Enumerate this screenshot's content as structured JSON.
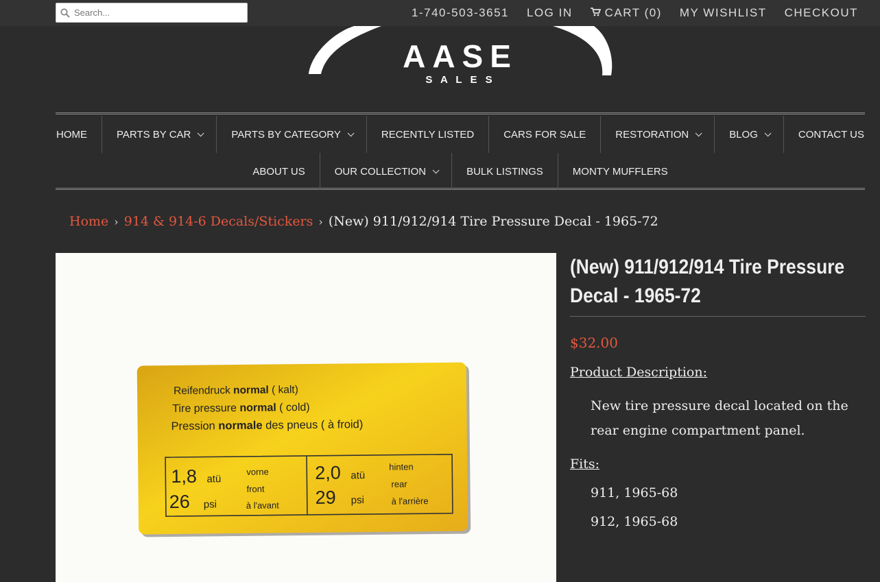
{
  "search": {
    "placeholder": "Search..."
  },
  "top_links": {
    "phone": "1-740-503-3651",
    "login": "LOG IN",
    "cart_label": "CART",
    "cart_count": "(0)",
    "wishlist": "MY WISHLIST",
    "checkout": "CHECKOUT"
  },
  "logo": {
    "text": "AASE",
    "subtext": "S A L E S"
  },
  "nav": {
    "row1": [
      {
        "label": "HOME",
        "dropdown": false
      },
      {
        "label": "PARTS BY CAR",
        "dropdown": true
      },
      {
        "label": "PARTS BY CATEGORY",
        "dropdown": true
      },
      {
        "label": "RECENTLY LISTED",
        "dropdown": false
      },
      {
        "label": "CARS FOR SALE",
        "dropdown": false
      },
      {
        "label": "RESTORATION",
        "dropdown": true
      },
      {
        "label": "BLOG",
        "dropdown": true
      },
      {
        "label": "CONTACT US",
        "dropdown": false
      }
    ],
    "row2": [
      {
        "label": "ABOUT US",
        "dropdown": false
      },
      {
        "label": "OUR COLLECTION",
        "dropdown": true
      },
      {
        "label": "BULK LISTINGS",
        "dropdown": false
      },
      {
        "label": "MONTY MUFFLERS",
        "dropdown": false
      }
    ]
  },
  "breadcrumb": {
    "home": "Home",
    "category": "914 & 914-6 Decals/Stickers",
    "current": "(New) 911/912/914 Tire Pressure Decal - 1965-72"
  },
  "decal": {
    "line1_a": "Reifendruck ",
    "line1_b": "normal",
    "line1_c": " ( kalt)",
    "line2_a": "Tire pressure ",
    "line2_b": "normal",
    "line2_c": " ( cold)",
    "line3_a": "Pression ",
    "line3_b": "normale",
    "line3_c": " des pneus ( à froid)",
    "front_atu": "1,8",
    "front_psi": "26",
    "rear_atu": "2,0",
    "rear_psi": "29",
    "unit_atu": "atü",
    "unit_psi": "psi",
    "front_de": "vorne",
    "front_en": "front",
    "front_fr": "à l'avant",
    "rear_de": "hinten",
    "rear_en": "rear",
    "rear_fr": "à l'arrière"
  },
  "product": {
    "title": "(New) 911/912/914 Tire Pressure Decal - 1965-72",
    "price": "$32.00",
    "desc_heading": "Product Description:",
    "description": "New tire pressure decal located on the rear engine compartment panel.",
    "fits_heading": "Fits:",
    "fits": [
      "911, 1965-68",
      "912, 1965-68"
    ]
  },
  "colors": {
    "accent": "#e4573f",
    "background": "#2c2c2c",
    "topbar": "#333333",
    "decal": "#f5c518"
  }
}
